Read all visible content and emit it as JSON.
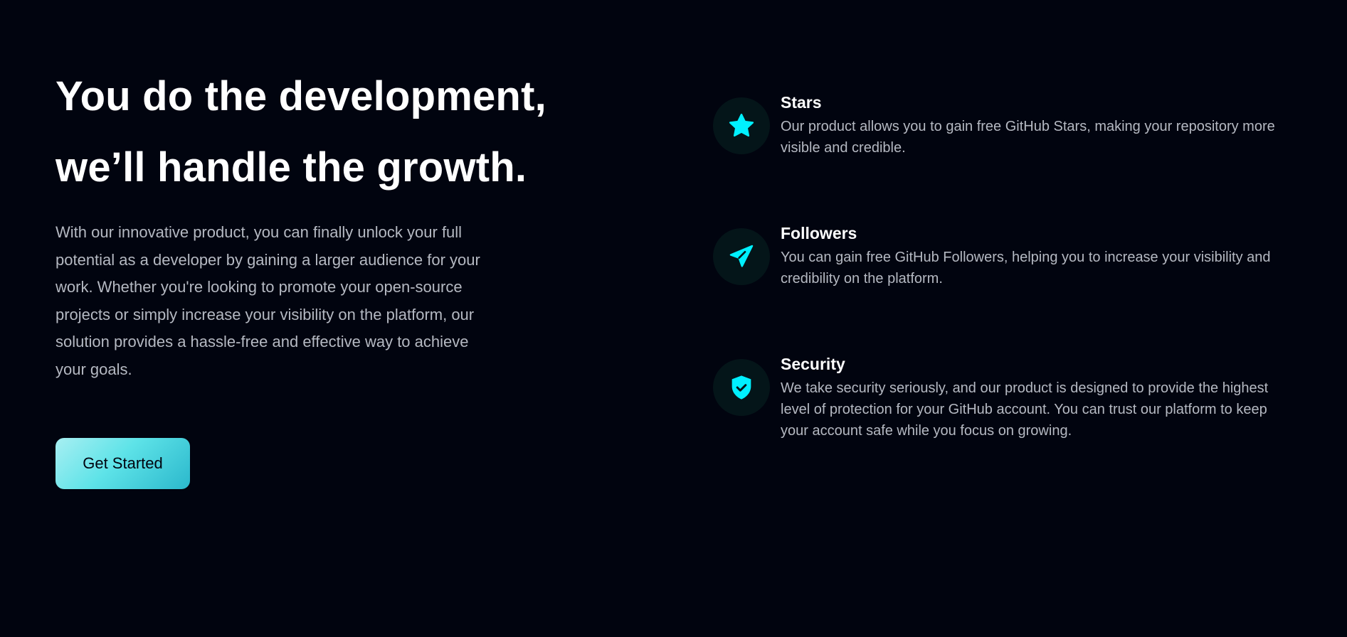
{
  "hero": {
    "title_line1": "You do the development,",
    "title_line2": "we’ll handle the growth.",
    "description": "With our innovative product, you can finally unlock your full potential as a developer by gaining a larger audience for your work. Whether you're looking to promote your open-source projects or simply increase your visibility on the platform, our solution provides a hassle-free and effective way to achieve your goals.",
    "cta_label": "Get Started"
  },
  "features": [
    {
      "icon": "star-icon",
      "title": "Stars",
      "description": "Our product allows you to gain free GitHub Stars, making your repository more visible and credible."
    },
    {
      "icon": "paper-plane-icon",
      "title": "Followers",
      "description": "You can gain free GitHub Followers, helping you to increase your visibility and credibility on the platform."
    },
    {
      "icon": "shield-check-icon",
      "title": "Security",
      "description": "We take security seriously, and our product is designed to provide the highest level of protection for your GitHub account. You can trust our platform to keep your account safe while you focus on growing."
    }
  ],
  "colors": {
    "accent": "#00f0ff",
    "background": "#01040f"
  }
}
